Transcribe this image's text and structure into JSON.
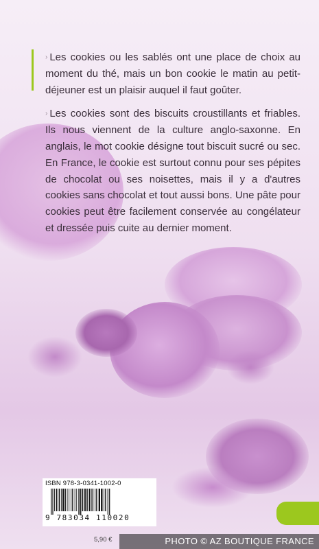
{
  "body": {
    "paragraphs": [
      "Les cookies ou les sablés ont une place de choix au moment du thé, mais un bon cookie le matin au petit-déjeuner est un plaisir auquel il faut goûter.",
      "Les cookies sont des biscuits croustillants et friables. Ils nous viennent de la culture anglo-saxonne. En anglais, le mot cookie désigne tout biscuit sucré ou sec. En France, le cookie est surtout connu pour ses pépites de chocolat ou ses noisettes, mais il y a d'autres cookies sans chocolat et tout aussi bons. Une pâte pour cookies peut être facilement conservée au congélateur et dressée puis cuite au dernier moment."
    ],
    "bullet_glyph": "›"
  },
  "barcode": {
    "isbn_label": "ISBN 978-3-0341-1002-0",
    "digits": "9 783034 110020"
  },
  "price": "5,90 €",
  "credit": "PHOTO © AZ BOUTIQUE FRANCE",
  "colors": {
    "accent_green": "#9cc81e",
    "text": "#3a2e3a",
    "background": "#efdff0"
  }
}
